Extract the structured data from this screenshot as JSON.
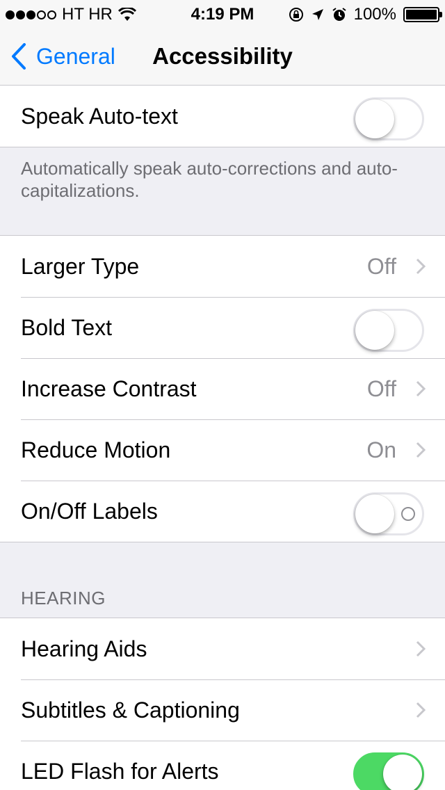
{
  "status_bar": {
    "carrier": "HT HR",
    "time": "4:19 PM",
    "battery": "100%"
  },
  "nav": {
    "back_label": "General",
    "title": "Accessibility"
  },
  "group1": {
    "speak_auto_text": {
      "label": "Speak Auto-text",
      "on": false
    }
  },
  "note1": "Automatically speak auto-corrections and auto-capitalizations.",
  "group2": {
    "larger_type": {
      "label": "Larger Type",
      "value": "Off"
    },
    "bold_text": {
      "label": "Bold Text",
      "on": false
    },
    "increase_contrast": {
      "label": "Increase Contrast",
      "value": "Off"
    },
    "reduce_motion": {
      "label": "Reduce Motion",
      "value": "On"
    },
    "on_off_labels": {
      "label": "On/Off Labels",
      "on": false
    }
  },
  "hearing_header": "HEARING",
  "group3": {
    "hearing_aids": {
      "label": "Hearing Aids"
    },
    "subtitles": {
      "label": "Subtitles & Captioning"
    },
    "led_flash": {
      "label": "LED Flash for Alerts",
      "on": true
    }
  },
  "colors": {
    "accent": "#007aff",
    "toggle_on": "#4cd964",
    "secondary_text": "#8e8e93"
  }
}
